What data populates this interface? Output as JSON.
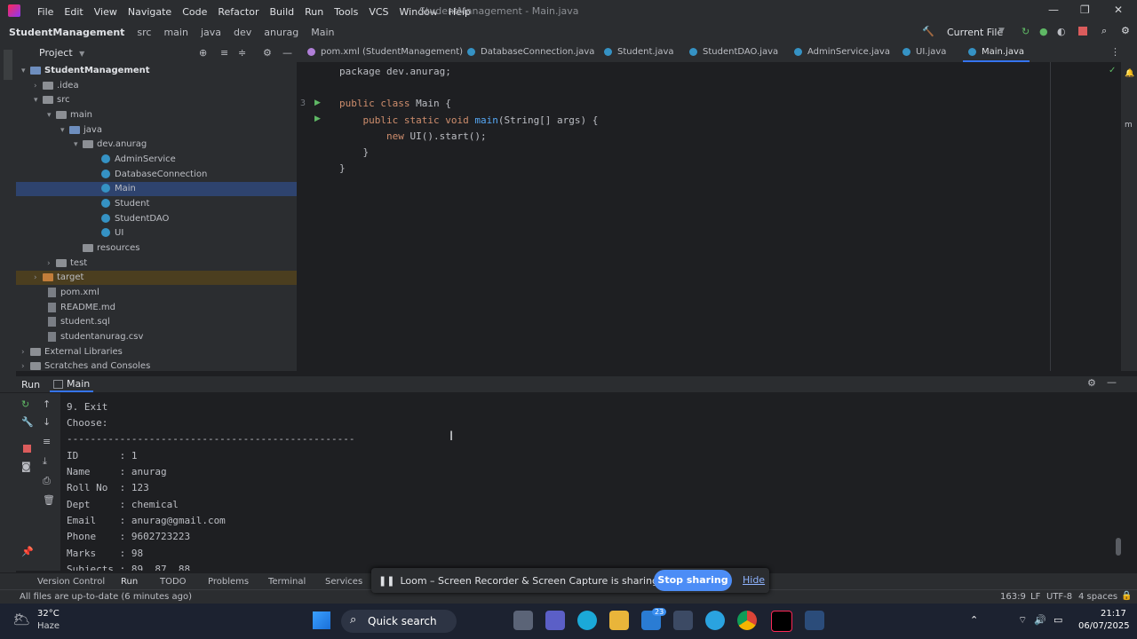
{
  "menu": [
    "File",
    "Edit",
    "View",
    "Navigate",
    "Code",
    "Refactor",
    "Build",
    "Run",
    "Tools",
    "VCS",
    "Window",
    "Help"
  ],
  "window_title": "StudentManagement - Main.java",
  "breadcrumbs": [
    "StudentManagement",
    "src",
    "main",
    "java",
    "dev",
    "anurag",
    "Main"
  ],
  "run_config": "Current File",
  "project": {
    "header": "Project",
    "root": "StudentManagement",
    "items": [
      ".idea",
      "src",
      "main",
      "java",
      "dev.anurag",
      "AdminService",
      "DatabaseConnection",
      "Main",
      "Student",
      "StudentDAO",
      "UI",
      "resources",
      "test",
      "target",
      "pom.xml",
      "README.md",
      "student.sql",
      "studentanurag.csv",
      "External Libraries",
      "Scratches and Consoles"
    ]
  },
  "tabs": [
    "pom.xml (StudentManagement)",
    "DatabaseConnection.java",
    "Student.java",
    "StudentDAO.java",
    "AdminService.java",
    "UI.java",
    "Main.java"
  ],
  "code": {
    "l1": "package dev.anurag;",
    "l3a": "public class ",
    "l3b": "Main",
    "l3c": " {",
    "l4a": "    public static void ",
    "l4b": "main",
    "l4c": "(String[] args) {",
    "l5a": "        new ",
    "l5b": "UI().start();",
    "l6": "    }",
    "l7": "}",
    "ln3": "3"
  },
  "run_panel": {
    "label": "Run",
    "tab": "Main"
  },
  "console": [
    "9. Exit",
    "Choose: ",
    "-------------------------------------------------",
    "ID       : 1",
    "Name     : anurag",
    "Roll No  : 123",
    "Dept     : chemical",
    "Email    : anurag@gmail.com",
    "Phone    : 9602723223",
    "Marks    : 98",
    "Subjects : 89, 87, 88"
  ],
  "bottom_tools": [
    "Version Control",
    "Run",
    "TODO",
    "Problems",
    "Terminal",
    "Services"
  ],
  "status": {
    "message": "All files are up-to-date (6 minutes ago)",
    "position": "163:9",
    "line_sep": "LF",
    "encoding": "UTF-8",
    "indent": "4 spaces"
  },
  "loom": {
    "message": "Loom – Screen Recorder & Screen Capture is sharing your screen.",
    "stop": "Stop sharing",
    "hide": "Hide"
  },
  "taskbar": {
    "weather_temp": "32°C",
    "weather_desc": "Haze",
    "search": "Quick search",
    "time": "21:17",
    "date": "06/07/2025",
    "badge": "23"
  },
  "colors": {
    "accent": "#3574f0",
    "selection": "#2e436e",
    "loom_button": "#4c8df6"
  }
}
